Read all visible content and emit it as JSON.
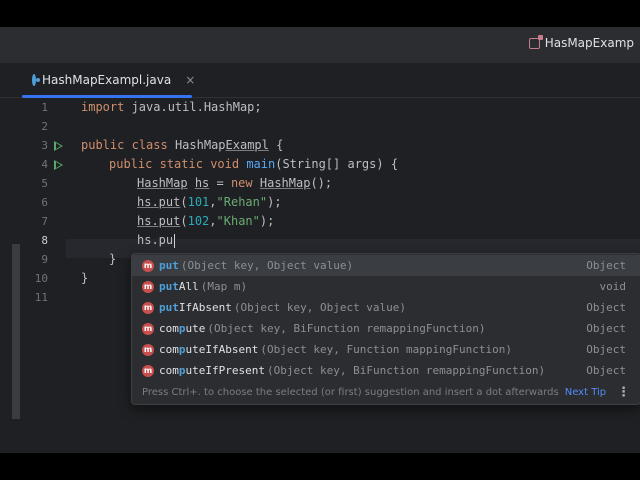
{
  "run_config": {
    "label": "HasMapExamp"
  },
  "tab": {
    "label": "HashMapExampl.java",
    "close": "×"
  },
  "line_numbers": [
    "1",
    "2",
    "3",
    "4",
    "5",
    "6",
    "7",
    "8",
    "9",
    "10",
    "11"
  ],
  "code": {
    "l1": {
      "kw": "import",
      "rest": " java.util.HashMap;"
    },
    "l3": {
      "kw1": "public",
      "kw2": "class",
      "name_plain": "HashMap",
      "name_ul": "Exampl",
      "tail": " {"
    },
    "l4": {
      "kw1": "public",
      "kw2": "static",
      "kw3": "void",
      "fn": "main",
      "tail": "(String[] args) {"
    },
    "l5": {
      "t1": "HashMap",
      "t2": "hs",
      "t3": " = ",
      "kw": "new",
      "t4": "HashMap",
      "t5": "();"
    },
    "l6": {
      "obj": "hs.put",
      "open": "(",
      "num": "101",
      "comma": ",",
      "str": "\"Rehan\"",
      "close": ");"
    },
    "l7": {
      "obj": "hs.put",
      "open": "(",
      "num": "102",
      "comma": ",",
      "str": "\"Khan\"",
      "close": ");"
    },
    "l8": {
      "text": "hs.pu"
    },
    "l9": {
      "text": "}"
    },
    "l10": {
      "text": "}"
    }
  },
  "completion": {
    "items": [
      {
        "match": "put",
        "rest": "",
        "params": "(Object key, Object value)",
        "type": "Object"
      },
      {
        "match": "put",
        "rest": "All",
        "params": "(Map m)",
        "type": "void"
      },
      {
        "match": "put",
        "rest": "IfAbsent",
        "params": "(Object key, Object value)",
        "type": "Object"
      },
      {
        "match": "p",
        "rest": "ute",
        "prefix": "com",
        "params": "(Object key, BiFunction remappingFunction)",
        "type": "Object"
      },
      {
        "match": "p",
        "rest": "uteIfAbsent",
        "prefix": "com",
        "params": "(Object key, Function mappingFunction)",
        "type": "Object"
      },
      {
        "match": "p",
        "rest": "uteIfPresent",
        "prefix": "com",
        "params": "(Object key, BiFunction remappingFunction)",
        "type": "Object"
      }
    ],
    "icon_letter": "m",
    "footer_text": "Press Ctrl+. to choose the selected (or first) suggestion and insert a dot afterwards",
    "next_tip": "Next Tip",
    "more": "⋮"
  }
}
